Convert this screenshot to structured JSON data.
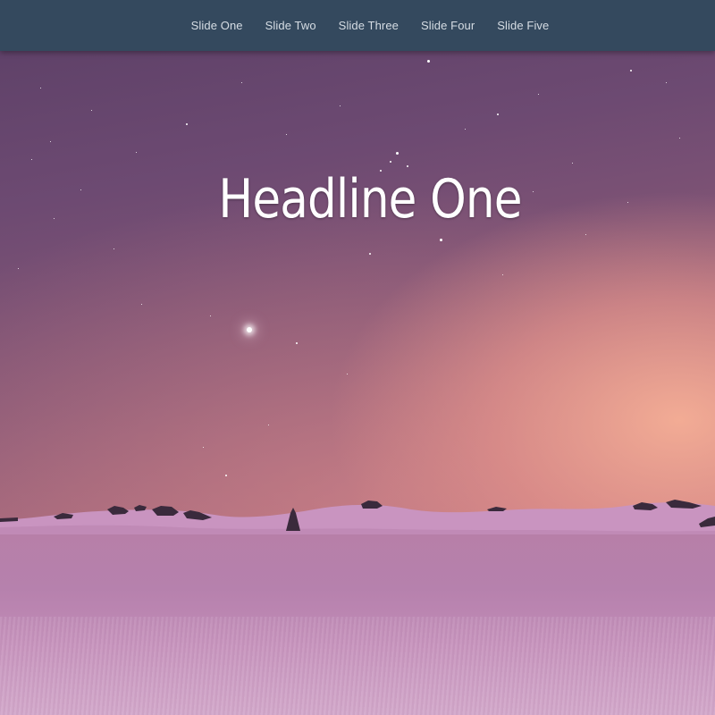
{
  "nav": {
    "items": [
      {
        "label": "Slide One"
      },
      {
        "label": "Slide Two"
      },
      {
        "label": "Slide Three"
      },
      {
        "label": "Slide Four"
      },
      {
        "label": "Slide Five"
      }
    ]
  },
  "hero": {
    "headline": "Headline One"
  },
  "colors": {
    "navbar": "#34495e",
    "nav_text": "#d6dde4",
    "headline_text": "#ffffff"
  }
}
